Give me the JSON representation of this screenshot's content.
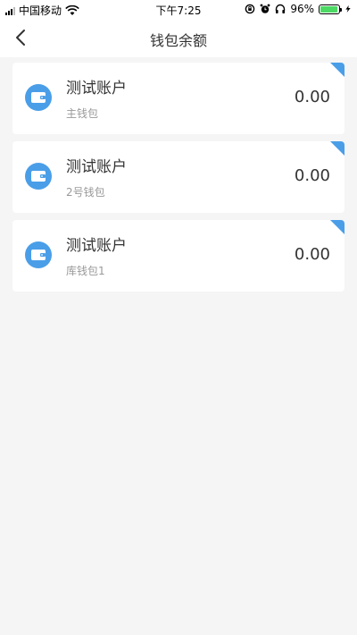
{
  "status": {
    "carrier": "中国移动",
    "time": "下午7:25",
    "battery": "96%",
    "battery_level": 0.96
  },
  "header": {
    "title": "钱包余额",
    "back_icon": "chevron-left-icon"
  },
  "accounts": [
    {
      "name": "测试账户",
      "wallet": "主钱包",
      "balance": "0.00",
      "icon": "wallet-icon"
    },
    {
      "name": "测试账户",
      "wallet": "2号钱包",
      "balance": "0.00",
      "icon": "wallet-icon"
    },
    {
      "name": "测试账户",
      "wallet": "库钱包1",
      "balance": "0.00",
      "icon": "wallet-icon"
    }
  ],
  "colors": {
    "accent": "#4a9ee8",
    "background": "#f5f5f5",
    "battery_fill": "#4cd964"
  }
}
